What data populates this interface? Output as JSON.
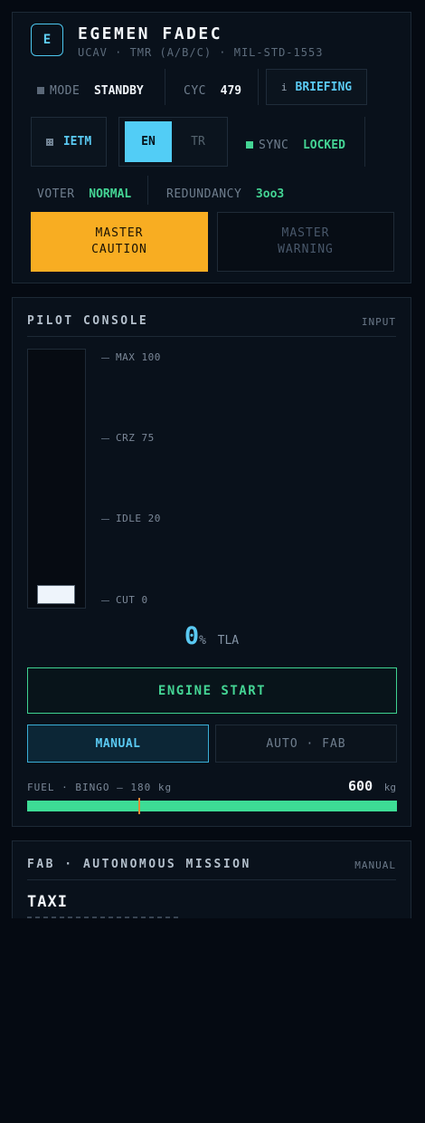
{
  "header": {
    "badge": "E",
    "title": "EGEMEN FADEC",
    "subtitle": "UCAV · TMR (A/B/C) · MIL-STD-1553"
  },
  "status": {
    "mode_label": "MODE",
    "mode_value": "STANDBY",
    "cycle_label": "CYC",
    "cycle_value": "479",
    "briefing_icon": "i",
    "briefing_label": "BRIEFING",
    "ietm_label": "IETM",
    "lang_en": "EN",
    "lang_tr": "TR",
    "sync_label": "SYNC",
    "sync_value": "LOCKED",
    "voter_label": "VOTER",
    "voter_value": "NORMAL",
    "redundancy_label": "REDUNDANCY",
    "redundancy_value": "3oo3"
  },
  "alerts": {
    "caution_line1": "MASTER",
    "caution_line2": "CAUTION",
    "warning_line1": "MASTER",
    "warning_line2": "WARNING"
  },
  "console": {
    "title": "PILOT CONSOLE",
    "tag": "INPUT",
    "detents": [
      {
        "label": "MAX 100"
      },
      {
        "label": "CRZ 75"
      },
      {
        "label": "IDLE 20"
      },
      {
        "label": "CUT 0"
      }
    ],
    "throttle_value": "0",
    "throttle_unit": "%",
    "throttle_label": "TLA",
    "throttle_fraction": 0,
    "engine_start_label": "ENGINE START",
    "manual_label": "MANUAL",
    "auto_label": "AUTO · FAB",
    "fuel_label": "FUEL · BINGO — 180 kg",
    "fuel_value": "600",
    "fuel_unit": "kg",
    "fuel_fraction": 1.0,
    "bingo_fraction": 0.3
  },
  "fab": {
    "title": "FAB · AUTONOMOUS MISSION",
    "tag": "MANUAL",
    "phase": "TAXI"
  },
  "colors": {
    "accent": "#4cc6ee",
    "caution": "#f8ad22",
    "ok": "#44d494",
    "active_lang_bg": "#52cdf6"
  }
}
